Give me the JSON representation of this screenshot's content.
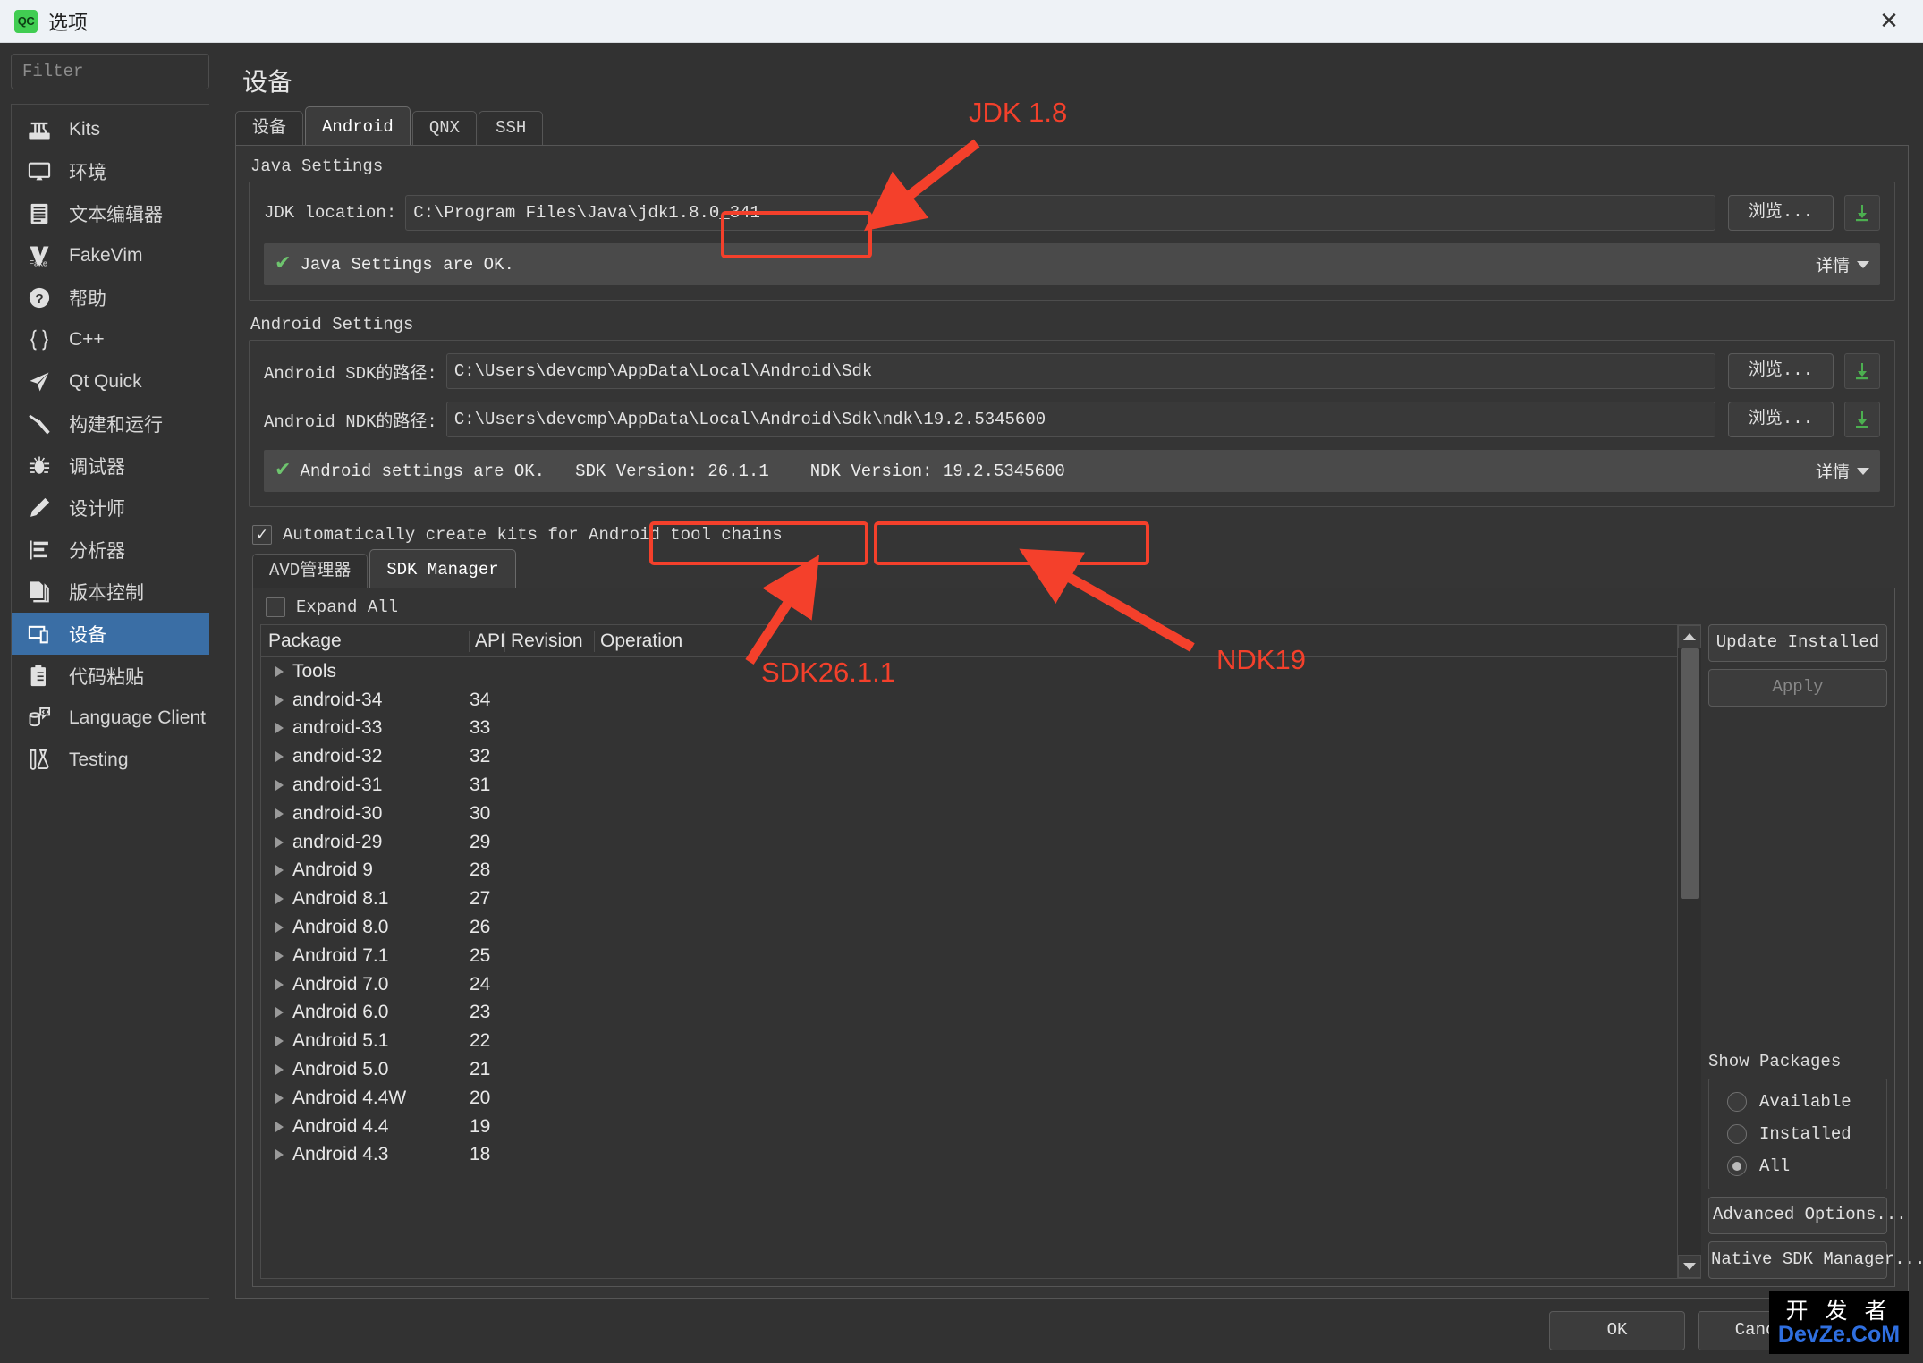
{
  "window": {
    "logo": "qc-logo",
    "title": "选项",
    "close": "✕"
  },
  "sidebar": {
    "filter_placeholder": "Filter",
    "items": [
      {
        "label": "Kits",
        "icon": "kits-icon",
        "selected": false
      },
      {
        "label": "环境",
        "icon": "monitor-icon",
        "selected": false
      },
      {
        "label": "文本编辑器",
        "icon": "text-document-icon",
        "selected": false
      },
      {
        "label": "FakeVim",
        "icon": "fakevim-icon",
        "selected": false
      },
      {
        "label": "帮助",
        "icon": "help-circle-icon",
        "selected": false
      },
      {
        "label": "C++",
        "icon": "braces-icon",
        "selected": false
      },
      {
        "label": "Qt Quick",
        "icon": "paper-plane-icon",
        "selected": false
      },
      {
        "label": "构建和运行",
        "icon": "hammer-icon",
        "selected": false
      },
      {
        "label": "调试器",
        "icon": "bug-icon",
        "selected": false
      },
      {
        "label": "设计师",
        "icon": "pencil-icon",
        "selected": false
      },
      {
        "label": "分析器",
        "icon": "analyzer-bars-icon",
        "selected": false
      },
      {
        "label": "版本控制",
        "icon": "copy-pages-icon",
        "selected": false
      },
      {
        "label": "设备",
        "icon": "devices-icon",
        "selected": true
      },
      {
        "label": "代码粘贴",
        "icon": "clipboard-icon",
        "selected": false
      },
      {
        "label": "Language Client",
        "icon": "language-client-icon",
        "selected": false
      },
      {
        "label": "Testing",
        "icon": "test-tube-icon",
        "selected": false
      }
    ]
  },
  "main": {
    "page_title": "设备",
    "tabs": [
      {
        "label": "设备",
        "selected": false
      },
      {
        "label": "Android",
        "selected": true
      },
      {
        "label": "QNX",
        "selected": false
      },
      {
        "label": "SSH",
        "selected": false
      }
    ],
    "java_settings": {
      "group_title": "Java Settings",
      "jdk_label": "JDK location:",
      "jdk_value": "C:\\Program Files\\Java\\jdk1.8.0_341",
      "browse_label": "浏览...",
      "download_icon": "download-icon",
      "status_check": "✔",
      "status_text": "Java Settings are OK.",
      "details_label": "详情"
    },
    "android_settings": {
      "group_title": "Android Settings",
      "sdk_label": "Android SDK的路径:",
      "sdk_value": "C:\\Users\\devcmp\\AppData\\Local\\Android\\Sdk",
      "ndk_label": "Android NDK的路径:",
      "ndk_value": "C:\\Users\\devcmp\\AppData\\Local\\Android\\Sdk\\ndk\\19.2.5345600",
      "browse_label": "浏览...",
      "status_check": "✔",
      "status_text": "Android settings are OK.",
      "sdk_version": "SDK Version: 26.1.1",
      "ndk_version": "NDK Version: 19.2.5345600",
      "details_label": "详情"
    },
    "auto_kits": {
      "checked": true,
      "check_glyph": "✓",
      "label": "Automatically create kits for Android tool chains"
    },
    "inner_tabs": [
      {
        "label": "AVD管理器",
        "selected": false
      },
      {
        "label": "SDK Manager",
        "selected": true
      }
    ],
    "expand_all": {
      "checked": false,
      "label": "Expand All"
    },
    "table": {
      "columns": [
        "Package",
        "API",
        "Revision",
        "Operation"
      ],
      "rows": [
        {
          "package": "Tools",
          "api": "",
          "revision": "",
          "operation": ""
        },
        {
          "package": "android-34",
          "api": "34",
          "revision": "",
          "operation": ""
        },
        {
          "package": "android-33",
          "api": "33",
          "revision": "",
          "operation": ""
        },
        {
          "package": "android-32",
          "api": "32",
          "revision": "",
          "operation": ""
        },
        {
          "package": "android-31",
          "api": "31",
          "revision": "",
          "operation": ""
        },
        {
          "package": "android-30",
          "api": "30",
          "revision": "",
          "operation": ""
        },
        {
          "package": "android-29",
          "api": "29",
          "revision": "",
          "operation": ""
        },
        {
          "package": "Android 9",
          "api": "28",
          "revision": "",
          "operation": ""
        },
        {
          "package": "Android 8.1",
          "api": "27",
          "revision": "",
          "operation": ""
        },
        {
          "package": "Android 8.0",
          "api": "26",
          "revision": "",
          "operation": ""
        },
        {
          "package": "Android 7.1",
          "api": "25",
          "revision": "",
          "operation": ""
        },
        {
          "package": "Android 7.0",
          "api": "24",
          "revision": "",
          "operation": ""
        },
        {
          "package": "Android 6.0",
          "api": "23",
          "revision": "",
          "operation": ""
        },
        {
          "package": "Android 5.1",
          "api": "22",
          "revision": "",
          "operation": ""
        },
        {
          "package": "Android 5.0",
          "api": "21",
          "revision": "",
          "operation": ""
        },
        {
          "package": "Android 4.4W",
          "api": "20",
          "revision": "",
          "operation": ""
        },
        {
          "package": "Android 4.4",
          "api": "19",
          "revision": "",
          "operation": ""
        },
        {
          "package": "Android 4.3",
          "api": "18",
          "revision": "",
          "operation": ""
        }
      ]
    },
    "side_panel": {
      "update_installed": "Update Installed",
      "apply": "Apply",
      "apply_disabled": true,
      "show_packages_title": "Show Packages",
      "radios": [
        {
          "label": "Available",
          "selected": false
        },
        {
          "label": "Installed",
          "selected": false
        },
        {
          "label": "All",
          "selected": true
        }
      ],
      "advanced_options": "Advanced Options...",
      "native_sdk_manager": "Native SDK Manager..."
    }
  },
  "bottom": {
    "ok": "OK",
    "cancel": "Cancel",
    "help": ""
  },
  "annotations": {
    "jdk_label": "JDK 1.8",
    "sdk_label": "SDK26.1.1",
    "ndk_label": "NDK19",
    "color": "#f4402b"
  },
  "watermark": {
    "line1": "开 发 者",
    "line2": "DevZe.CoM"
  }
}
